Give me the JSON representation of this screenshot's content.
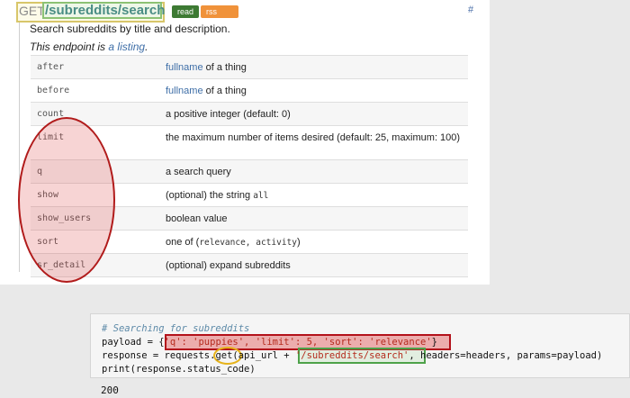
{
  "endpoint": {
    "method": "GET",
    "path": "/subreddits/search",
    "badges": [
      "read",
      "rss support"
    ],
    "anchor": "#",
    "description": "Search subreddits by title and description.",
    "listing_prefix": "This endpoint is ",
    "listing_link": "a listing",
    "listing_suffix": "."
  },
  "params": [
    {
      "name": "after",
      "link": "fullname",
      "desc": " of a thing"
    },
    {
      "name": "before",
      "link": "fullname",
      "desc": " of a thing"
    },
    {
      "name": "count",
      "desc": "a positive integer (default: 0)"
    },
    {
      "name": "limit",
      "desc": "the maximum number of items desired (default: 25, maximum: 100)"
    },
    {
      "name": "q",
      "desc": "a search query"
    },
    {
      "name": "show",
      "desc_pre": "(optional) the string ",
      "code": "all"
    },
    {
      "name": "show_users",
      "desc": "boolean value"
    },
    {
      "name": "sort",
      "desc_pre": "one of (",
      "code": "relevance, activity",
      "desc_post": ")"
    },
    {
      "name": "sr_detail",
      "desc": "(optional) expand subreddits"
    }
  ],
  "code": {
    "comment": "# Searching for subreddits",
    "line2_a": "payload = {",
    "line2_dict": "'q': 'puppies', 'limit': 5, 'sort': 'relevance'",
    "line2_b": "}",
    "line3_a": "response = requests.",
    "line3_get": "get",
    "line3_b": "(api_url + ",
    "line3_str": "'/subreddits/search'",
    "line3_c": ", headers=headers, params=payload)",
    "line4": "print(response.status_code)",
    "output": "200"
  }
}
